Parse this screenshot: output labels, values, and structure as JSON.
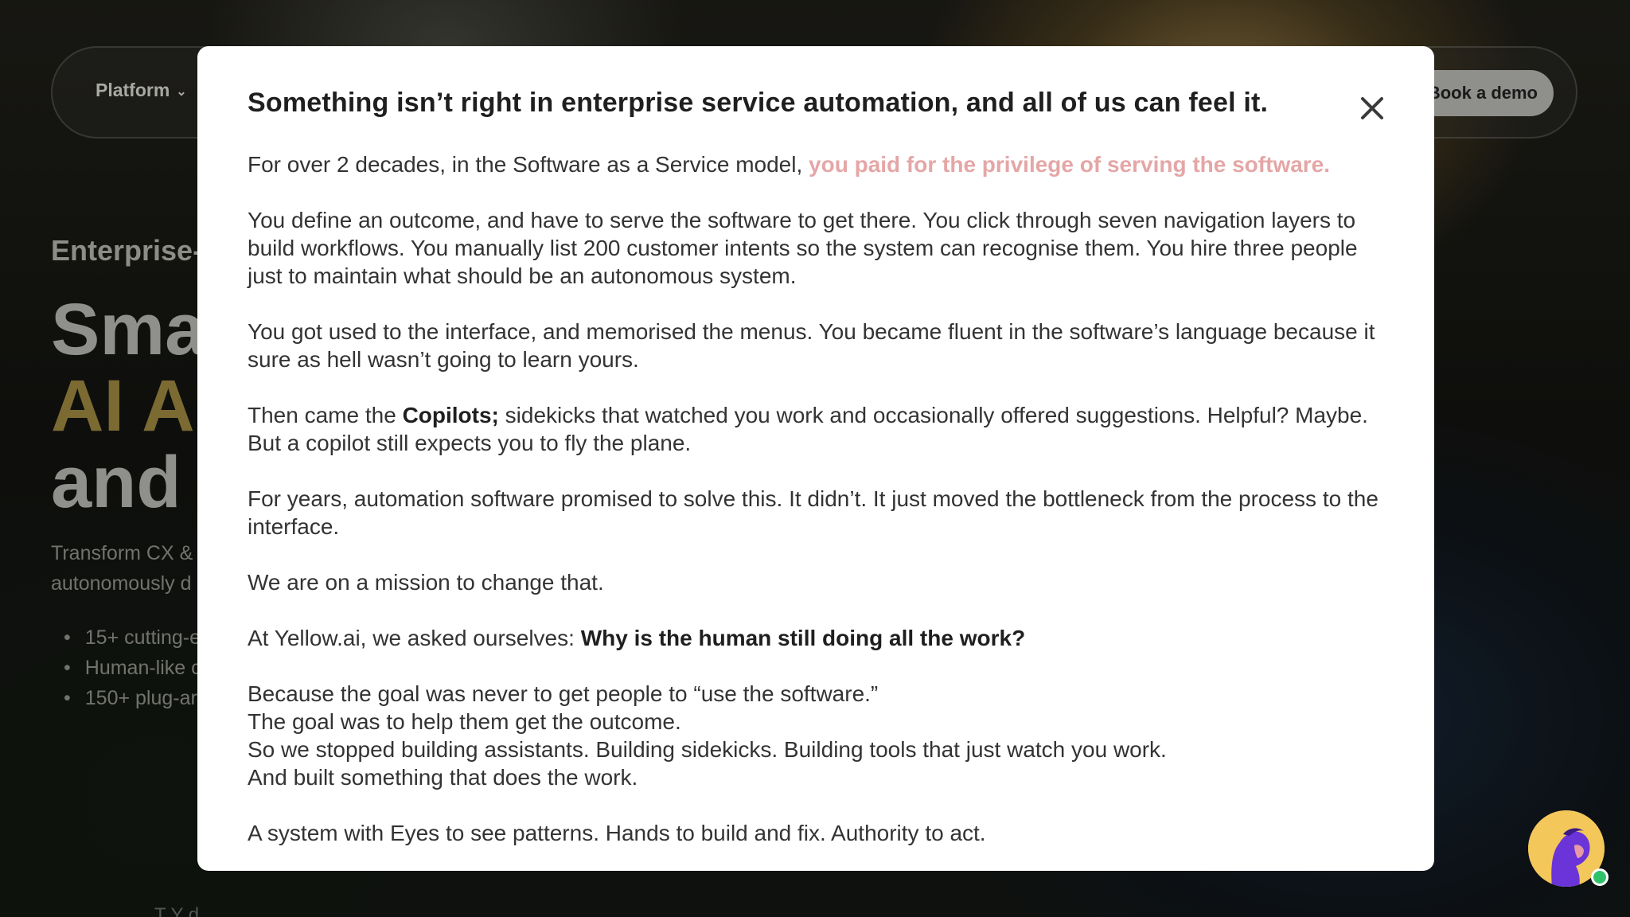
{
  "header": {
    "nav_platform_label": "Platform",
    "book_demo_label": "Book a demo"
  },
  "hero": {
    "eyebrow": "Enterprise-g",
    "title_line1": "Sma",
    "title_line2": "AI Ag",
    "title_line3": "and I",
    "subtitle_line1": "Transform CX &",
    "subtitle_line2": "autonomously d",
    "bullets": [
      "15+ cutting-e",
      "Human-like c",
      "150+ plug-ar"
    ],
    "footer_fragment": "T      Y       d"
  },
  "modal": {
    "title": "Something isn’t right in enterprise service automation, and all of us can feel it.",
    "p1_text": "For over 2 decades, in the Software as a Service model, ",
    "p1_highlight": "you paid for the privilege of serving the software.",
    "p2": "You define an outcome, and have to serve the software to get there. You click through seven navigation layers to build workflows. You manually list 200 customer intents so the system can recognise them. You hire three people just to maintain what should be an autonomous system.",
    "p3": "You got used to the interface, and memorised the menus. You became fluent in the software’s language because it sure as hell wasn’t going to learn yours.",
    "p4_before": "Then came the ",
    "p4_bold": "Copilots;",
    "p4_after": " sidekicks that watched you work and occasionally offered suggestions. Helpful? Maybe. But a copilot still expects you to fly the plane.",
    "p5": "For years, automation software promised to solve this. It didn’t. It just moved the bottleneck from the process to the interface.",
    "p6": "We are on a mission to change that.",
    "p7_before": "At Yellow.ai, we asked ourselves: ",
    "p7_bold": "Why is the human still doing all the work?",
    "p8_lines": [
      "Because the goal was never to get people to “use the software.”",
      "The goal was to help them get the outcome.",
      "So we stopped building assistants. Building sidekicks. Building tools that just watch you work.",
      "And built something that does the work."
    ],
    "p9": "A system with Eyes to see patterns. Hands to build and fix. Authority to act."
  },
  "icons": {
    "close": "close-icon",
    "chevron": "chevron-down-icon",
    "chat": "chat-assistant-avatar-icon"
  },
  "colors": {
    "accent_pink": "#e5a6a6",
    "status_online": "#2fc26a",
    "avatar_bg": "#f4c75a"
  }
}
